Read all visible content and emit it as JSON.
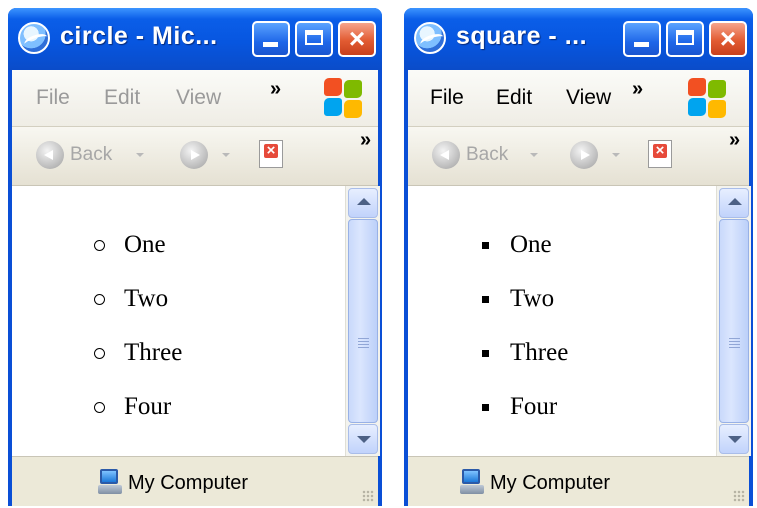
{
  "windows": [
    {
      "title": "circle - Mic...",
      "bullet_style": "circle",
      "menu": [
        "File",
        "Edit",
        "View"
      ],
      "menu_overflow": "»",
      "toolbar": {
        "back_label": "Back",
        "overflow": "»"
      },
      "items": [
        "One",
        "Two",
        "Three",
        "Four"
      ],
      "status": "My Computer",
      "menu_enabled": false
    },
    {
      "title": "square - ...",
      "bullet_style": "square",
      "menu": [
        "File",
        "Edit",
        "View"
      ],
      "menu_overflow": "»",
      "toolbar": {
        "back_label": "Back",
        "overflow": "»"
      },
      "items": [
        "One",
        "Two",
        "Three",
        "Four"
      ],
      "status": "My Computer",
      "menu_enabled": true
    }
  ],
  "icons": {
    "title": "ie-icon",
    "minimize": "minimize-icon",
    "maximize": "maximize-icon",
    "close": "close-icon",
    "windows_logo": "windows-logo-icon",
    "back": "back-arrow-icon",
    "forward": "forward-arrow-icon",
    "stop": "stop-icon",
    "status": "my-computer-icon"
  },
  "colors": {
    "titlebar": "#0756e0",
    "close_button": "#e25b32",
    "menu_disabled": "#9a9a9a",
    "menu_enabled": "#000000"
  }
}
